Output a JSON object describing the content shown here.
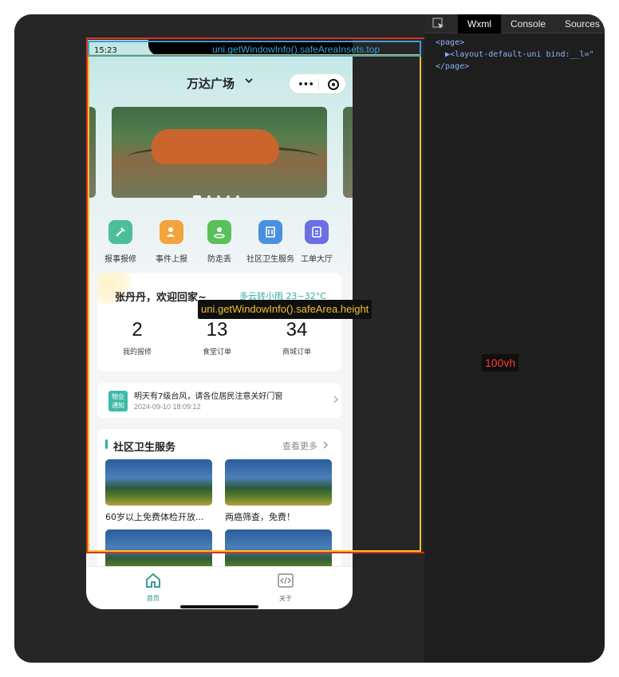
{
  "devtools": {
    "tabs": [
      "Wxml",
      "Console",
      "Sources"
    ],
    "code_lines": [
      "<page>",
      "  ▶<layout-default-uni bind:__l=\"",
      "</page>"
    ]
  },
  "status": {
    "time": "15:23"
  },
  "navbar": {
    "title": "万达广场",
    "more_glyph": "•••"
  },
  "banner": {
    "slides": 5,
    "active_index": 0
  },
  "quick_actions": [
    {
      "label": "报事报修",
      "icon": "repair-icon",
      "color": "#4cbf9a"
    },
    {
      "label": "事件上报",
      "icon": "report-person-icon",
      "color": "#f3a33a"
    },
    {
      "label": "防走丢",
      "icon": "location-person-icon",
      "color": "#5bbf5a"
    },
    {
      "label": "社区卫生服务",
      "icon": "building-icon",
      "color": "#4b8fe0"
    },
    {
      "label": "工单大厅",
      "icon": "clipboard-icon",
      "color": "#6b6fe6"
    }
  ],
  "user_card": {
    "greeting": "张丹丹，欢迎回家~",
    "weather": "多云转小雨 23~32°C",
    "stats": [
      {
        "value": "2",
        "label": "我的报修"
      },
      {
        "value": "13",
        "label": "食堂订单"
      },
      {
        "value": "34",
        "label": "商城订单"
      }
    ]
  },
  "notice": {
    "tag_line1": "物业",
    "tag_line2": "通知",
    "text": "明天有7级台风，请各位居民注意关好门窗",
    "time": "2024-09-10 18:09:12"
  },
  "health": {
    "title": "社区卫生服务",
    "more": "查看更多",
    "articles": [
      {
        "title": "60岁以上免费体检开放..."
      },
      {
        "title": "两癌筛查，免费！"
      },
      {
        "title": ""
      },
      {
        "title": ""
      }
    ]
  },
  "tabbar": {
    "items": [
      {
        "label": "首页",
        "icon": "home-icon",
        "active": true
      },
      {
        "label": "关于",
        "icon": "code-icon",
        "active": false
      }
    ],
    "active_color": "#2a8f86"
  },
  "annotations": {
    "safe_top": "uni.getWindowInfo().safeAreaInsets.top",
    "safe_height": "uni.getWindowInfo().safeArea.height",
    "full_height": "100vh"
  }
}
